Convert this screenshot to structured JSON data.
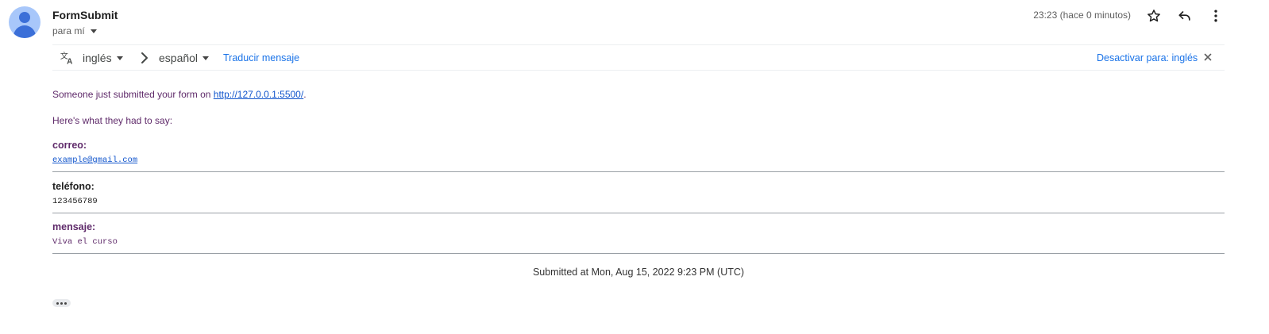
{
  "header": {
    "sender": "FormSubmit",
    "recipient": "para mí",
    "time": "23:23 (hace 0 minutos)",
    "icons": [
      "star-icon",
      "reply-icon",
      "more-vert-icon"
    ]
  },
  "translate": {
    "source_lang": "inglés",
    "target_lang": "español",
    "translate_label": "Traducir mensaje",
    "disable_label": "Desactivar para: inglés"
  },
  "body": {
    "intro_prefix": "Someone just submitted your form on ",
    "intro_link": "http://127.0.0.1:5500/",
    "intro_suffix": ".",
    "subheading": "Here's what they had to say:",
    "fields": [
      {
        "label": "correo:",
        "value": "example@gmail.com"
      },
      {
        "label": "teléfono:",
        "value": "123456789"
      },
      {
        "label": "mensaje:",
        "value": "Viva el curso"
      }
    ],
    "submitted": "Submitted at Mon, Aug 15, 2022 9:23 PM (UTC)"
  },
  "colors": {
    "accent_link": "#1a73e8",
    "body_purple": "#5f2a6a",
    "avatar_bg": "#a8c7fa",
    "avatar_fg": "#3b6fd8"
  }
}
